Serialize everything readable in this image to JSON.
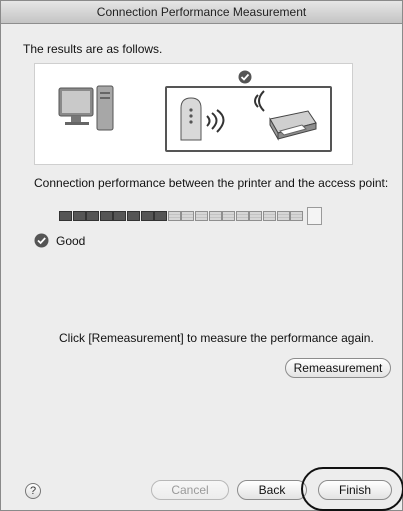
{
  "window": {
    "title": "Connection Performance Measurement"
  },
  "intro_text": "The results are as follows.",
  "diagram": {
    "icons": [
      "computer-icon",
      "access-point-icon",
      "printer-icon",
      "check-icon"
    ]
  },
  "performance": {
    "label": "Connection performance between the printer and the access point:",
    "level_strong": 8,
    "level_total": 18,
    "result_icon": "check-icon",
    "result_text": "Good"
  },
  "remeasure": {
    "hint": "Click [Remeasurement] to measure the performance again.",
    "button_label": "Remeasurement"
  },
  "footer": {
    "help_label": "?",
    "cancel_label": "Cancel",
    "back_label": "Back",
    "finish_label": "Finish"
  }
}
